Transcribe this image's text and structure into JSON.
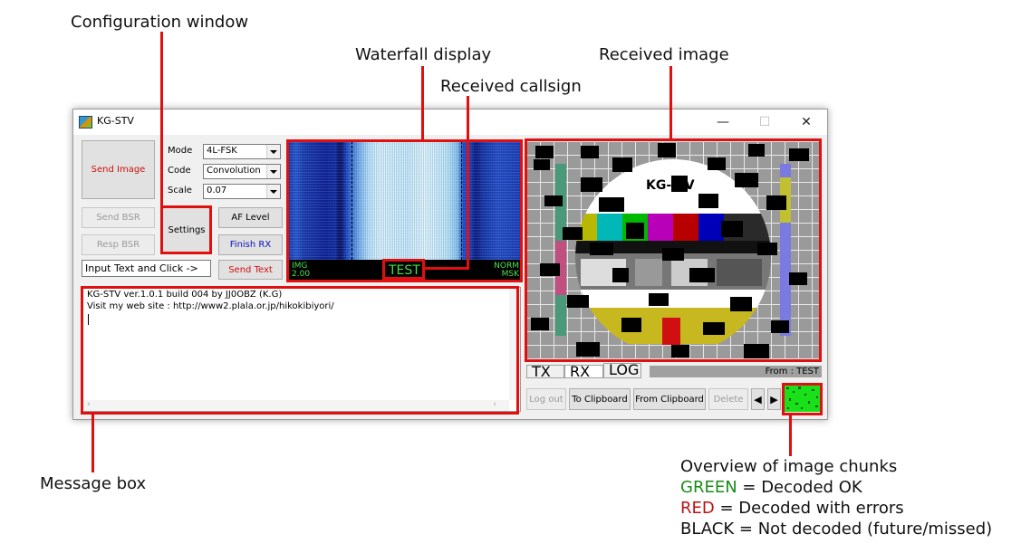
{
  "annotations": {
    "config_window": "Configuration window",
    "waterfall": "Waterfall display",
    "received_image": "Received image",
    "received_callsign": "Received callsign",
    "message_box": "Message box",
    "chunks_title": "Overview of image chunks",
    "green_word": "GREEN",
    "green_desc": " = Decoded OK",
    "red_word": "RED",
    "red_desc": " = Decoded with errors",
    "black_word": "BLACK",
    "black_desc": " = Not decoded (future/missed)"
  },
  "window": {
    "title": "KG-STV",
    "minimize": "—",
    "maximize": "☐",
    "close": "✕"
  },
  "left_panel": {
    "send_image": "Send Image",
    "send_bsr": "Send BSR",
    "resp_bsr": "Resp BSR",
    "text_input": "Input Text and Click ->"
  },
  "config": {
    "mode_label": "Mode",
    "mode_value": "4L-FSK",
    "code_label": "Code",
    "code_value": "Convolution",
    "scale_label": "Scale",
    "scale_value": "0.07",
    "settings": "Settings",
    "af_level": "AF Level",
    "finish_rx": "Finish RX",
    "send_text": "Send Text"
  },
  "waterfall": {
    "img_label": "IMG",
    "img_value": "2.00",
    "callsign": "TEST",
    "norm": "NORM",
    "msk": "MSK"
  },
  "message_box": {
    "line1": "KG-STV ver.1.0.1 build 004  by JJ0OBZ (K.G)",
    "line2": "Visit my web site : http://www2.plala.or.jp/hikokibiyori/"
  },
  "image_panel": {
    "logo_text": "KG-   V",
    "tab_tx": "TX",
    "tab_rx": "RX",
    "tab_log": "LOG",
    "from": "From : TEST",
    "log_out": "Log out",
    "to_clipboard": "To Clipboard",
    "from_clipboard": "From Clipboard",
    "delete": "Delete"
  },
  "colors": {
    "annotation_red": "#e01010",
    "green_text": "#1a8c1a",
    "red_text": "#c01010",
    "send_red": "#d01010",
    "finish_blue": "#1010c0",
    "callsign_green": "#45e045"
  }
}
